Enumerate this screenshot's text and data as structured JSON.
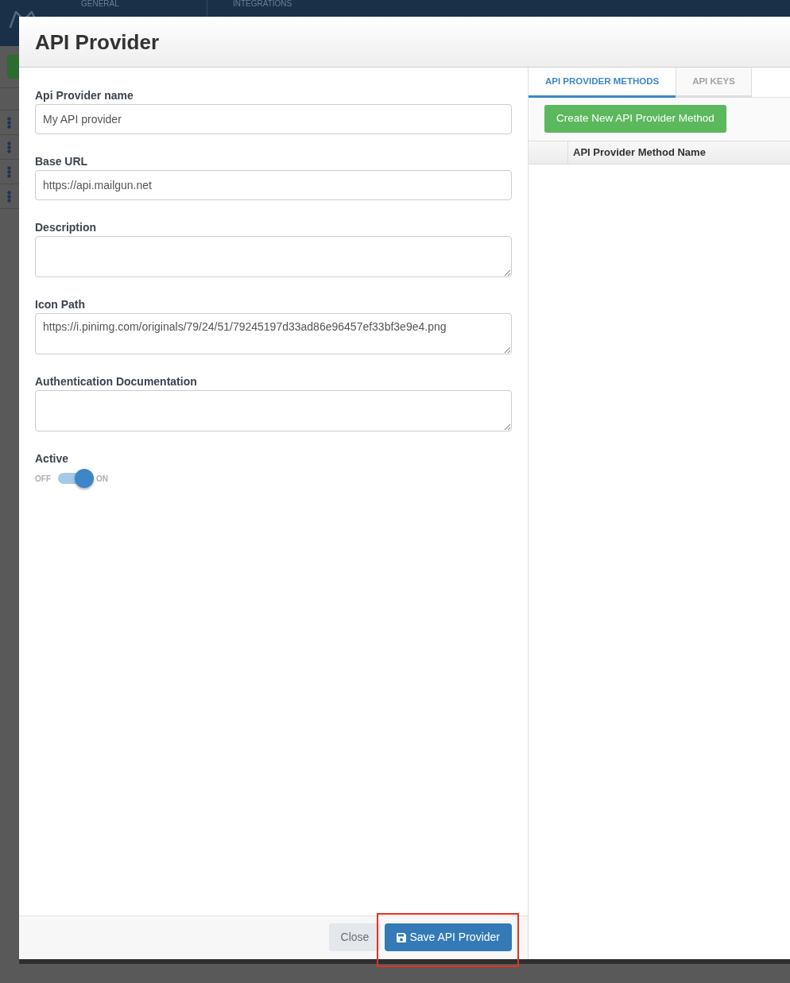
{
  "background": {
    "nav_tabs": [
      {
        "label": "GENERAL"
      },
      {
        "label": "INTEGRATIONS"
      }
    ]
  },
  "modal": {
    "title": "API Provider",
    "form": {
      "fields": [
        {
          "label": "Api Provider name",
          "kind": "input",
          "value": "My API provider"
        },
        {
          "label": "Base URL",
          "kind": "input",
          "value": "https://api.mailgun.net"
        },
        {
          "label": "Description",
          "kind": "textarea"
        },
        {
          "label": "Icon Path",
          "kind": "textarea",
          "value": "https://i.pinimg.com/originals/79/24/51/79245197d33ad86e96457ef33bf3e9e4.png"
        },
        {
          "label": "Authentication Documentation",
          "kind": "textarea"
        }
      ],
      "active": {
        "label": "Active",
        "off_label": "OFF",
        "on_label": "ON",
        "on": true
      }
    },
    "footer_buttons": [
      {
        "label": "Close",
        "kind": "secondary",
        "highlighted": false
      },
      {
        "label": "Save API Provider",
        "kind": "primary",
        "highlighted": true
      }
    ],
    "side_panel": {
      "tabs": [
        {
          "label": "API PROVIDER METHODS",
          "selected": true
        },
        {
          "label": "API KEYS",
          "selected": false
        }
      ],
      "create_button": "Create New API Provider Method",
      "table": {
        "columns": [
          "API Provider Method Name"
        ]
      }
    }
  }
}
